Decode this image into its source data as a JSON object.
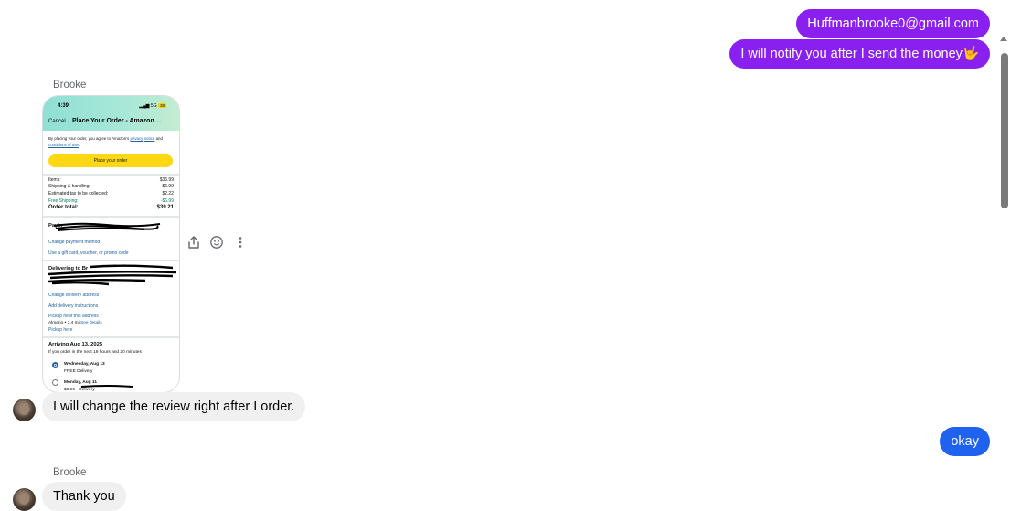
{
  "colors": {
    "outgoing_purple": "#8a20f0",
    "outgoing_blue": "#1f62f0",
    "incoming_bg": "#f0f0f0"
  },
  "messages": {
    "out_email": "Huffmanbrooke0@gmail.com",
    "out_notify": "I will notify you after I send the money",
    "out_notify_emoji": "🤟",
    "sender_1": "Brooke",
    "in_review": "I will change the review right after I order.",
    "out_okay": "okay",
    "sender_2": "Brooke",
    "in_thanks": "Thank you"
  },
  "screenshot": {
    "time": "4:39",
    "signal": "5G",
    "battery": "38",
    "cancel": "Cancel",
    "title": "Place Your Order - Amazon....",
    "terms_1": "By placing your order, you agree to Amazon's",
    "terms_link_1": "privacy",
    "terms_link_2": "notice",
    "terms_and": "and",
    "terms_link_3": "conditions of use",
    "place_order": "Place your order",
    "items_label": "Items:",
    "items_value": "$36.99",
    "shipping_label": "Shipping & handling:",
    "shipping_value": "$6.99",
    "tax_label": "Estimated tax to be collected:",
    "tax_value": "$2.22",
    "free_label": "Free Shipping:",
    "free_value": "-$6.99",
    "total_label": "Order total:",
    "total_value": "$39.21",
    "payment_head": "Payin",
    "change_payment": "Change payment method",
    "gift_card": "Use a gift card, voucher, or promo code",
    "delivering": "Delivering to Br",
    "change_address": "Change delivery address",
    "add_instructions": "Add delivery instructions",
    "pickup_near": "Pickup near this address",
    "pickup_info": "Almerio • 3.4 mi",
    "see_details": "See details",
    "pickup_here": "Pickup here",
    "arriving": "Arriving Aug 13, 2025",
    "order_within": "If you order in the next 19 hours and 20 minutes",
    "opt1_day": "Wednesday, Aug 13",
    "opt1_note": "FREE Delivery",
    "opt2_day": "Monday, Aug 11",
    "opt2_note": "$6.99 - Delivery"
  }
}
